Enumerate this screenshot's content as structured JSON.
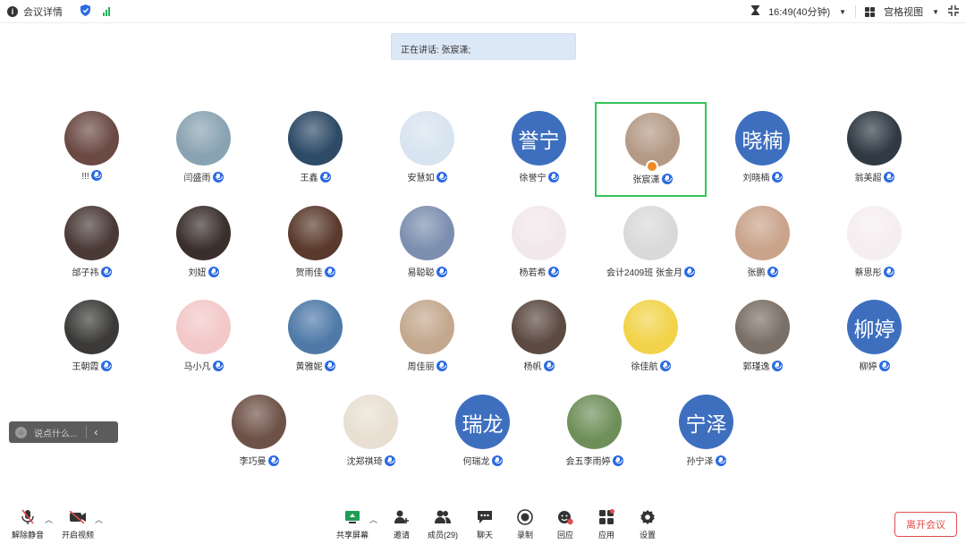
{
  "topbar": {
    "meeting_info": "会议详情",
    "time": "16:49(40分钟)",
    "view_mode": "宫格视图"
  },
  "speaking_banner": "正在讲话: 张宸潇;",
  "participants": [
    {
      "name": "!!!",
      "avatar_text": "",
      "color": "#6b4a44"
    },
    {
      "name": "闫盛雨",
      "avatar_text": "",
      "color": "#8aa3b2"
    },
    {
      "name": "王鑫",
      "avatar_text": "",
      "color": "#2d4a66"
    },
    {
      "name": "安慧如",
      "avatar_text": "",
      "color": "#d8e4f0"
    },
    {
      "name": "徐誉宁",
      "avatar_text": "誉宁",
      "color": "#3e6fbf"
    },
    {
      "name": "张宸潇",
      "avatar_text": "",
      "color": "#b49a86"
    },
    {
      "name": "刘晓楠",
      "avatar_text": "晓楠",
      "color": "#3e6fbf"
    },
    {
      "name": "翁美超",
      "avatar_text": "",
      "color": "#2f3a44"
    },
    {
      "name": "邰子祎",
      "avatar_text": "",
      "color": "#4a3a36"
    },
    {
      "name": "刘妞",
      "avatar_text": "",
      "color": "#3a2f2c"
    },
    {
      "name": "贺雨佳",
      "avatar_text": "",
      "color": "#5a3a2c"
    },
    {
      "name": "易聪聪",
      "avatar_text": "",
      "color": "#7c8fb0"
    },
    {
      "name": "杨若希",
      "avatar_text": "",
      "color": "#f2e8ec"
    },
    {
      "name": "会计2409班 张金月",
      "avatar_text": "",
      "color": "#d9d9d9"
    },
    {
      "name": "张鹏",
      "avatar_text": "",
      "color": "#c9a38a"
    },
    {
      "name": "蔡思彤",
      "avatar_text": "",
      "color": "#f5eef0"
    },
    {
      "name": "王朝霞",
      "avatar_text": "",
      "color": "#3b3a38"
    },
    {
      "name": "马小凡",
      "avatar_text": "",
      "color": "#f3c8c8"
    },
    {
      "name": "黄雅妮",
      "avatar_text": "",
      "color": "#4f7aa8"
    },
    {
      "name": "周佳丽",
      "avatar_text": "",
      "color": "#c3a88e"
    },
    {
      "name": "杨帆",
      "avatar_text": "",
      "color": "#5c4a42"
    },
    {
      "name": "徐佳航",
      "avatar_text": "",
      "color": "#f2d34a"
    },
    {
      "name": "郭瑾逸",
      "avatar_text": "",
      "color": "#7a6f66"
    },
    {
      "name": "柳婷",
      "avatar_text": "柳婷",
      "color": "#3e6fbf"
    },
    {
      "name": "李巧曼",
      "avatar_text": "",
      "color": "#6e5248"
    },
    {
      "name": "沈郑祺琦",
      "avatar_text": "",
      "color": "#e8dfd2"
    },
    {
      "name": "何瑞龙",
      "avatar_text": "瑞龙",
      "color": "#3e6fbf"
    },
    {
      "name": "会五李雨婷",
      "avatar_text": "",
      "color": "#6f8f5a"
    },
    {
      "name": "孙宁泽",
      "avatar_text": "宁泽",
      "color": "#3e6fbf"
    }
  ],
  "chat": {
    "placeholder": "说点什么..."
  },
  "toolbar": {
    "unmute": "解除静音",
    "start_video": "开启视频",
    "share_screen": "共享屏幕",
    "invite": "邀请",
    "members": "成员(29)",
    "chat": "聊天",
    "record": "录制",
    "playback": "回应",
    "apps": "应用",
    "settings": "设置",
    "leave": "离开会议"
  },
  "colors": {
    "accent": "#2a6ae3",
    "active_border": "#34c55a",
    "leave": "#e44d4d",
    "avatar_blue": "#3e6fbf"
  }
}
